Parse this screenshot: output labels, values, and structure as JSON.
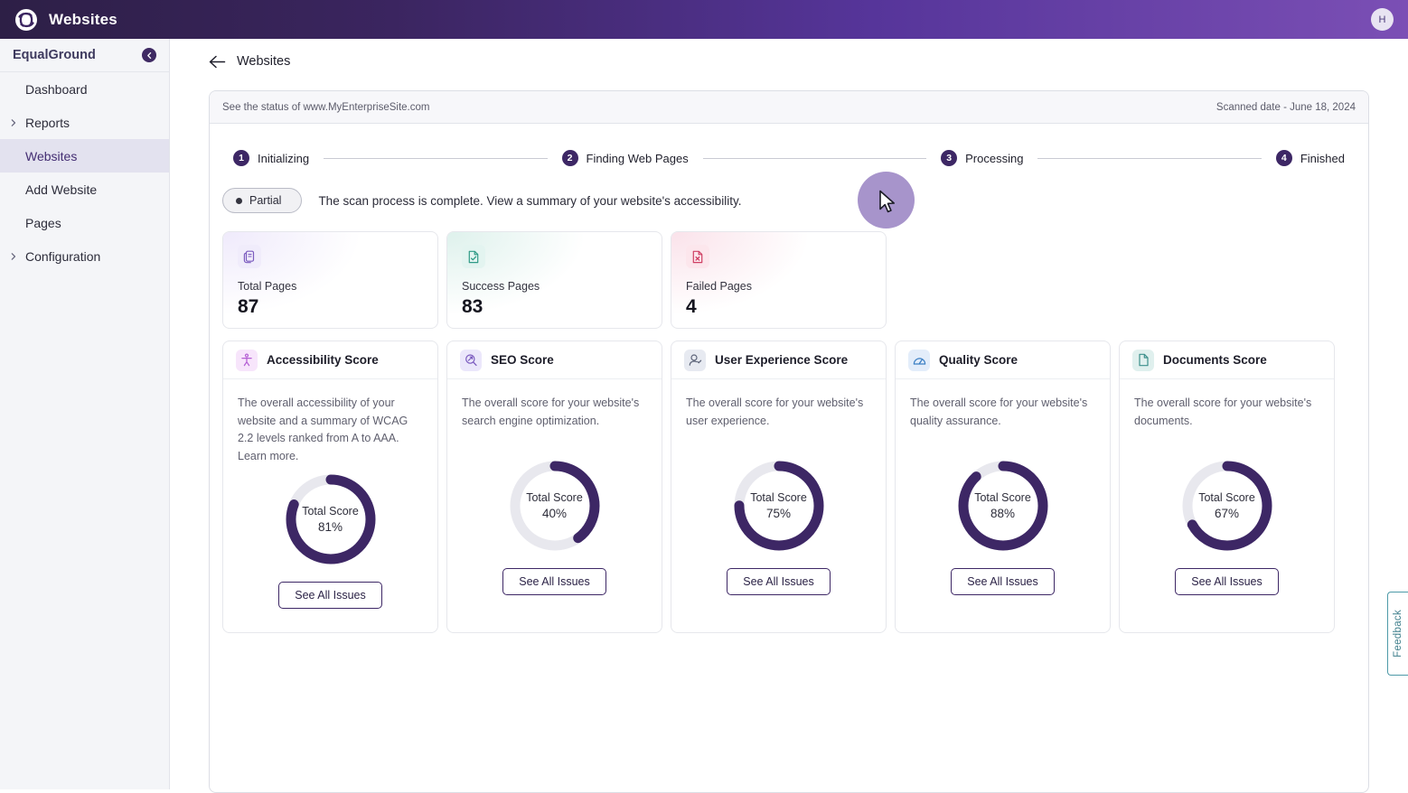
{
  "topbar": {
    "logo_icon": "swirl-logo-icon",
    "title": "Websites",
    "avatar_initial": "H"
  },
  "sidebar": {
    "brand": "EqualGround",
    "collapse_icon": "chevron-left-icon",
    "items": [
      {
        "label": "Dashboard",
        "expandable": false,
        "active": false
      },
      {
        "label": "Reports",
        "expandable": true,
        "active": false
      },
      {
        "label": "Websites",
        "expandable": false,
        "active": true
      },
      {
        "label": "Add Website",
        "expandable": false,
        "active": false
      },
      {
        "label": "Pages",
        "expandable": false,
        "active": false
      },
      {
        "label": "Configuration",
        "expandable": true,
        "active": false
      }
    ]
  },
  "breadcrumb": {
    "back_icon": "arrow-left-icon",
    "label": "Websites"
  },
  "panel": {
    "status_line": "See the status of www.MyEnterpriseSite.com",
    "scanned_date": "Scanned date - June 18, 2024"
  },
  "stepper": {
    "steps": [
      {
        "number": "1",
        "label": "Initializing"
      },
      {
        "number": "2",
        "label": "Finding Web Pages"
      },
      {
        "number": "3",
        "label": "Processing"
      },
      {
        "number": "4",
        "label": "Finished"
      }
    ]
  },
  "status": {
    "badge": "Partial",
    "message": "The scan process is complete. View a summary of your website's accessibility."
  },
  "stats": [
    {
      "icon": "pages-copy-icon",
      "tone": "purple",
      "label": "Total Pages",
      "value": "87"
    },
    {
      "icon": "document-check-icon",
      "tone": "teal",
      "label": "Success Pages",
      "value": "83"
    },
    {
      "icon": "document-x-icon",
      "tone": "pink",
      "label": "Failed Pages",
      "value": "4"
    }
  ],
  "scores": [
    {
      "icon": "accessibility-person-icon",
      "tone": "a11y",
      "title": "Accessibility Score",
      "description": "The overall accessibility of your website and a summary of WCAG 2.2 levels ranked from A to AAA. Learn more.",
      "score_label": "Total Score",
      "score_value": "81%",
      "percent": 81,
      "button": "See All Issues"
    },
    {
      "icon": "seo-magnifier-arrow-icon",
      "tone": "seo",
      "title": "SEO Score",
      "description": "The overall score for your website's search engine optimization.",
      "score_label": "Total Score",
      "score_value": "40%",
      "percent": 40,
      "button": "See All Issues"
    },
    {
      "icon": "user-check-icon",
      "tone": "ux",
      "title": "User Experience Score",
      "description": "The overall score for your website's user experience.",
      "score_label": "Total Score",
      "score_value": "75%",
      "percent": 75,
      "button": "See All Issues"
    },
    {
      "icon": "gauge-icon",
      "tone": "qa",
      "title": "Quality Score",
      "description": "The overall score for your website's quality assurance.",
      "score_label": "Total Score",
      "score_value": "88%",
      "percent": 88,
      "button": "See All Issues"
    },
    {
      "icon": "file-icon",
      "tone": "docs",
      "title": "Documents Score",
      "description": "The overall score for your website's documents.",
      "score_label": "Total Score",
      "score_value": "67%",
      "percent": 67,
      "button": "See All Issues"
    }
  ],
  "feedback": {
    "label": "Feedback"
  },
  "colors": {
    "brand_purple": "#3d2765",
    "donut_track": "#e8e8ee",
    "header_gradient_start": "#2d1f46",
    "header_gradient_end": "#7b4fb5",
    "feedback_teal": "#4e9aa8"
  }
}
